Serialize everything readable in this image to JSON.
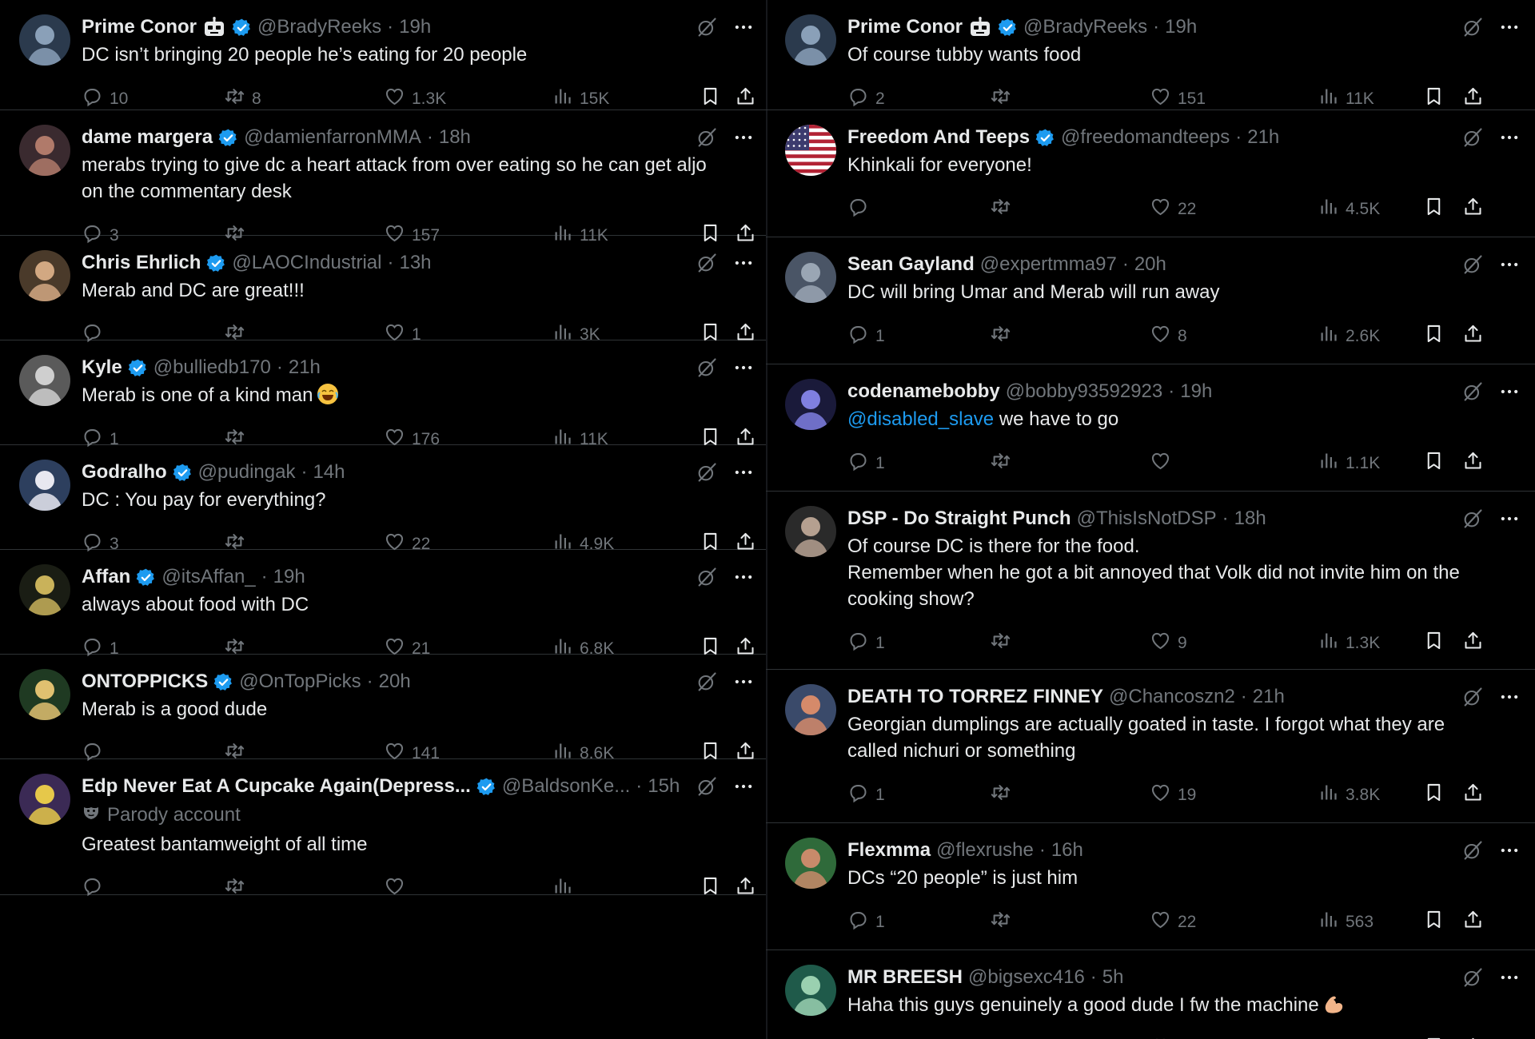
{
  "left": [
    {
      "name": "Prime Conor",
      "robot": true,
      "verified": true,
      "handle": "@BradyReeks",
      "time": "19h",
      "lines": [
        "DC isn’t bringing 20 people he’s eating for 20 people"
      ],
      "replies": "10",
      "reposts": "8",
      "likes": "1.3K",
      "views": "15K",
      "avatar_color": "#2b3a4d",
      "avatar_fg": "#8aa0b8"
    },
    {
      "name": "dame margera",
      "verified": true,
      "handle": "@damienfarronMMA",
      "time": "18h",
      "lines": [
        "merabs trying to give dc a heart attack from over eating so he can get aljo",
        "on the commentary desk"
      ],
      "replies": "3",
      "reposts": "",
      "likes": "157",
      "views": "11K",
      "avatar_color": "#3a2a2f",
      "avatar_fg": "#b07a6a"
    },
    {
      "name": "Chris Ehrlich",
      "verified": true,
      "handle": "@LAOCIndustrial",
      "time": "13h",
      "lines": [
        "Merab and DC are great!!!"
      ],
      "replies": "",
      "reposts": "",
      "likes": "1",
      "views": "3K",
      "avatar_color": "#4a3a2a",
      "avatar_fg": "#d2a882"
    },
    {
      "name": "Kyle",
      "verified": true,
      "handle": "@bulliedb170",
      "time": "21h",
      "lines": [
        "Merab is one of a kind man"
      ],
      "emoji": "laugh",
      "replies": "1",
      "reposts": "",
      "likes": "176",
      "views": "11K",
      "avatar_color": "#5a5a5a",
      "avatar_fg": "#cfcfcf"
    },
    {
      "name": "Godralho",
      "verified": true,
      "handle": "@pudingak",
      "time": "14h",
      "lines": [
        "DC : You pay for everything?"
      ],
      "replies": "3",
      "reposts": "",
      "likes": "22",
      "views": "4.9K",
      "avatar_color": "#2d3f5e",
      "avatar_fg": "#e8e8f0"
    },
    {
      "name": "Affan",
      "verified": true,
      "handle": "@itsAffan_",
      "time": "19h",
      "lines": [
        "always about food with DC"
      ],
      "replies": "1",
      "reposts": "",
      "likes": "21",
      "views": "6.8K",
      "avatar_color": "#1a1d14",
      "avatar_fg": "#c9b25a"
    },
    {
      "name": "ONTOPPICKS",
      "verified": true,
      "handle": "@OnTopPicks",
      "time": "20h",
      "lines": [
        "Merab is a good dude"
      ],
      "replies": "",
      "reposts": "",
      "likes": "141",
      "views": "8.6K",
      "avatar_color": "#1f3a22",
      "avatar_fg": "#e0c070"
    },
    {
      "name": "Edp Never Eat A Cupcake Again(Depress...",
      "verified": true,
      "handle": "@BaldsonKe...",
      "time": "15h",
      "parody": "Parody account",
      "lines": [
        "Greatest bantamweight of all time"
      ],
      "replies": "",
      "reposts": "",
      "likes": "",
      "views": "",
      "avatar_color": "#3b2a55",
      "avatar_fg": "#e6c84a"
    }
  ],
  "right": [
    {
      "name": "Prime Conor",
      "robot": true,
      "verified": true,
      "handle": "@BradyReeks",
      "time": "19h",
      "lines": [
        "Of course tubby wants food"
      ],
      "replies": "2",
      "reposts": "",
      "likes": "151",
      "views": "11K",
      "avatar_color": "#2b3a4d",
      "avatar_fg": "#8aa0b8"
    },
    {
      "name": "Freedom And Teeps",
      "verified": true,
      "handle": "@freedomandteeps",
      "time": "21h",
      "lines": [
        "Khinkali for everyone!"
      ],
      "replies": "",
      "reposts": "",
      "likes": "22",
      "views": "4.5K",
      "avatar_color": "#b22234",
      "avatar_fg": "#ffffff",
      "flag": true
    },
    {
      "name": "Sean Gayland",
      "verified": false,
      "handle": "@expertmma97",
      "time": "20h",
      "lines": [
        "DC will bring Umar and Merab will run away"
      ],
      "replies": "1",
      "reposts": "",
      "likes": "8",
      "views": "2.6K",
      "avatar_color": "#4a5566",
      "avatar_fg": "#9aa6b4"
    },
    {
      "name": "codenamebobby",
      "verified": false,
      "handle": "@bobby93592923",
      "time": "19h",
      "mention": "@disabled_slave",
      "lines": [
        "we have to go"
      ],
      "replies": "1",
      "reposts": "",
      "likes": "",
      "views": "1.1K",
      "avatar_color": "#1a1a3a",
      "avatar_fg": "#7f7fe0"
    },
    {
      "name": "DSP - Do Straight Punch",
      "verified": false,
      "handle": "@ThisIsNotDSP",
      "time": "18h",
      "lines": [
        "Of course DC is there for the food.",
        "Remember when he got a bit annoyed that Volk did not invite him on the",
        "cooking show?"
      ],
      "replies": "1",
      "reposts": "",
      "likes": "9",
      "views": "1.3K",
      "avatar_color": "#2a2a2a",
      "avatar_fg": "#b5a090"
    },
    {
      "name": "DEATH TO TORREZ FINNEY",
      "verified": false,
      "handle": "@Chancoszn2",
      "time": "21h",
      "lines": [
        "Georgian dumplings are actually goated in taste. I forgot what they are",
        "called nichuri or something"
      ],
      "replies": "1",
      "reposts": "",
      "likes": "19",
      "views": "3.8K",
      "avatar_color": "#3a4a6a",
      "avatar_fg": "#d58a6a"
    },
    {
      "name": "Flexmma",
      "verified": false,
      "handle": "@flexrushe",
      "time": "16h",
      "lines": [
        "DCs “20 people” is just him"
      ],
      "replies": "1",
      "reposts": "",
      "likes": "22",
      "views": "563",
      "avatar_color": "#2f6a3a",
      "avatar_fg": "#c88a6a"
    },
    {
      "name": "MR BREESH",
      "verified": false,
      "handle": "@bigsexc416",
      "time": "5h",
      "lines": [
        "Haha this guys genuinely a good dude I fw the machine"
      ],
      "emoji": "muscle",
      "replies": "",
      "reposts": "",
      "likes": "",
      "views": "",
      "avatar_color": "#1f5a4a",
      "avatar_fg": "#9ad0b0"
    }
  ],
  "icons": {
    "reply": "reply-icon",
    "repost": "repost-icon",
    "like": "like-icon",
    "views": "views-icon",
    "bookmark": "bookmark-icon",
    "share": "share-icon",
    "grok": "grok-icon",
    "more": "more-icon"
  },
  "colors": {
    "background": "#000000",
    "text": "#e7e9ea",
    "muted": "#71767b",
    "link": "#1d9bf0",
    "verified": "#1d9bf0",
    "border": "#2f3336"
  }
}
